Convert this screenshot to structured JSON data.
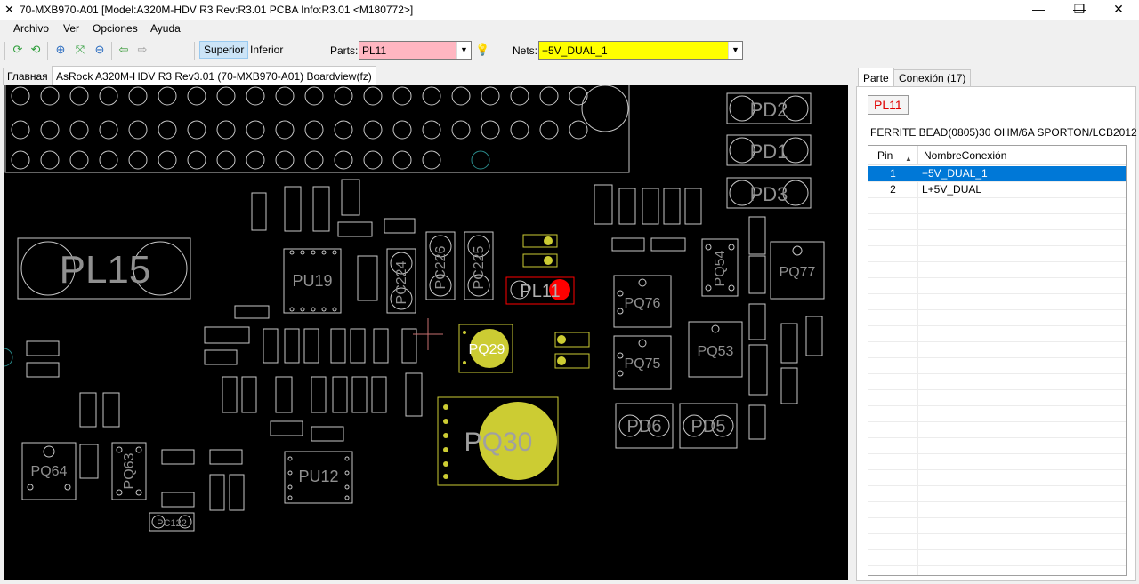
{
  "window": {
    "title": "70-MXB970-A01 [Model:A320M-HDV R3 Rev:R3.01 PCBA Info:R3.01   <M180772>]",
    "app_icon": "x-arrows-icon",
    "minimize": "—",
    "restore": "❐",
    "close": "✕"
  },
  "menu": [
    "Archivo",
    "Ver",
    "Opciones",
    "Ayuda"
  ],
  "toolbar": {
    "icons": [
      "refresh-green-icon",
      "refresh-green-2-icon",
      "zoom-in-icon",
      "zoom-fit-icon",
      "zoom-out-icon",
      "arrow-left-icon",
      "arrow-right-icon"
    ],
    "side_top": "Superior",
    "side_bottom": "Inferior",
    "parts_label": "Parts:",
    "parts_value": "PL11",
    "parts_color": "#ffb6c1",
    "nets_label": "Nets:",
    "nets_value": "+5V_DUAL_1",
    "nets_color": "#ffff00"
  },
  "tabs": {
    "home": "Главная",
    "doc": "AsRock A320M-HDV R3 Rev3.01 (70-MXB970-A01) Boardview(fz)"
  },
  "board": {
    "background": "#000000",
    "outline_color": "#c8c8c8",
    "highlight_color": "#cccc33",
    "selected_color": "#ff0000",
    "parts": [
      {
        "label": "PD2"
      },
      {
        "label": "PD1"
      },
      {
        "label": "PD3"
      },
      {
        "label": "PL15"
      },
      {
        "label": "PU19"
      },
      {
        "label": "PC224"
      },
      {
        "label": "PC226"
      },
      {
        "label": "PC225"
      },
      {
        "label": "PL11"
      },
      {
        "label": "PQ29"
      },
      {
        "label": "PQ76"
      },
      {
        "label": "PQ54"
      },
      {
        "label": "PQ77"
      },
      {
        "label": "PQ75"
      },
      {
        "label": "PQ53"
      },
      {
        "label": "PQ30"
      },
      {
        "label": "PD6"
      },
      {
        "label": "PD5"
      },
      {
        "label": "PQ64"
      },
      {
        "label": "PQ63"
      },
      {
        "label": "PU12"
      },
      {
        "label": "PC122"
      }
    ]
  },
  "side": {
    "tab_part": "Parte",
    "tab_conn": "Conexión (17)",
    "part": "PL11",
    "description": "FERRITE BEAD(0805)30 OHM/6A SPORTON/LCB2012",
    "columns": [
      "Pin",
      "NombreConexión"
    ],
    "rows": [
      {
        "pin": "1",
        "net": "+5V_DUAL_1",
        "selected": true
      },
      {
        "pin": "2",
        "net": "L+5V_DUAL",
        "selected": false
      }
    ]
  }
}
